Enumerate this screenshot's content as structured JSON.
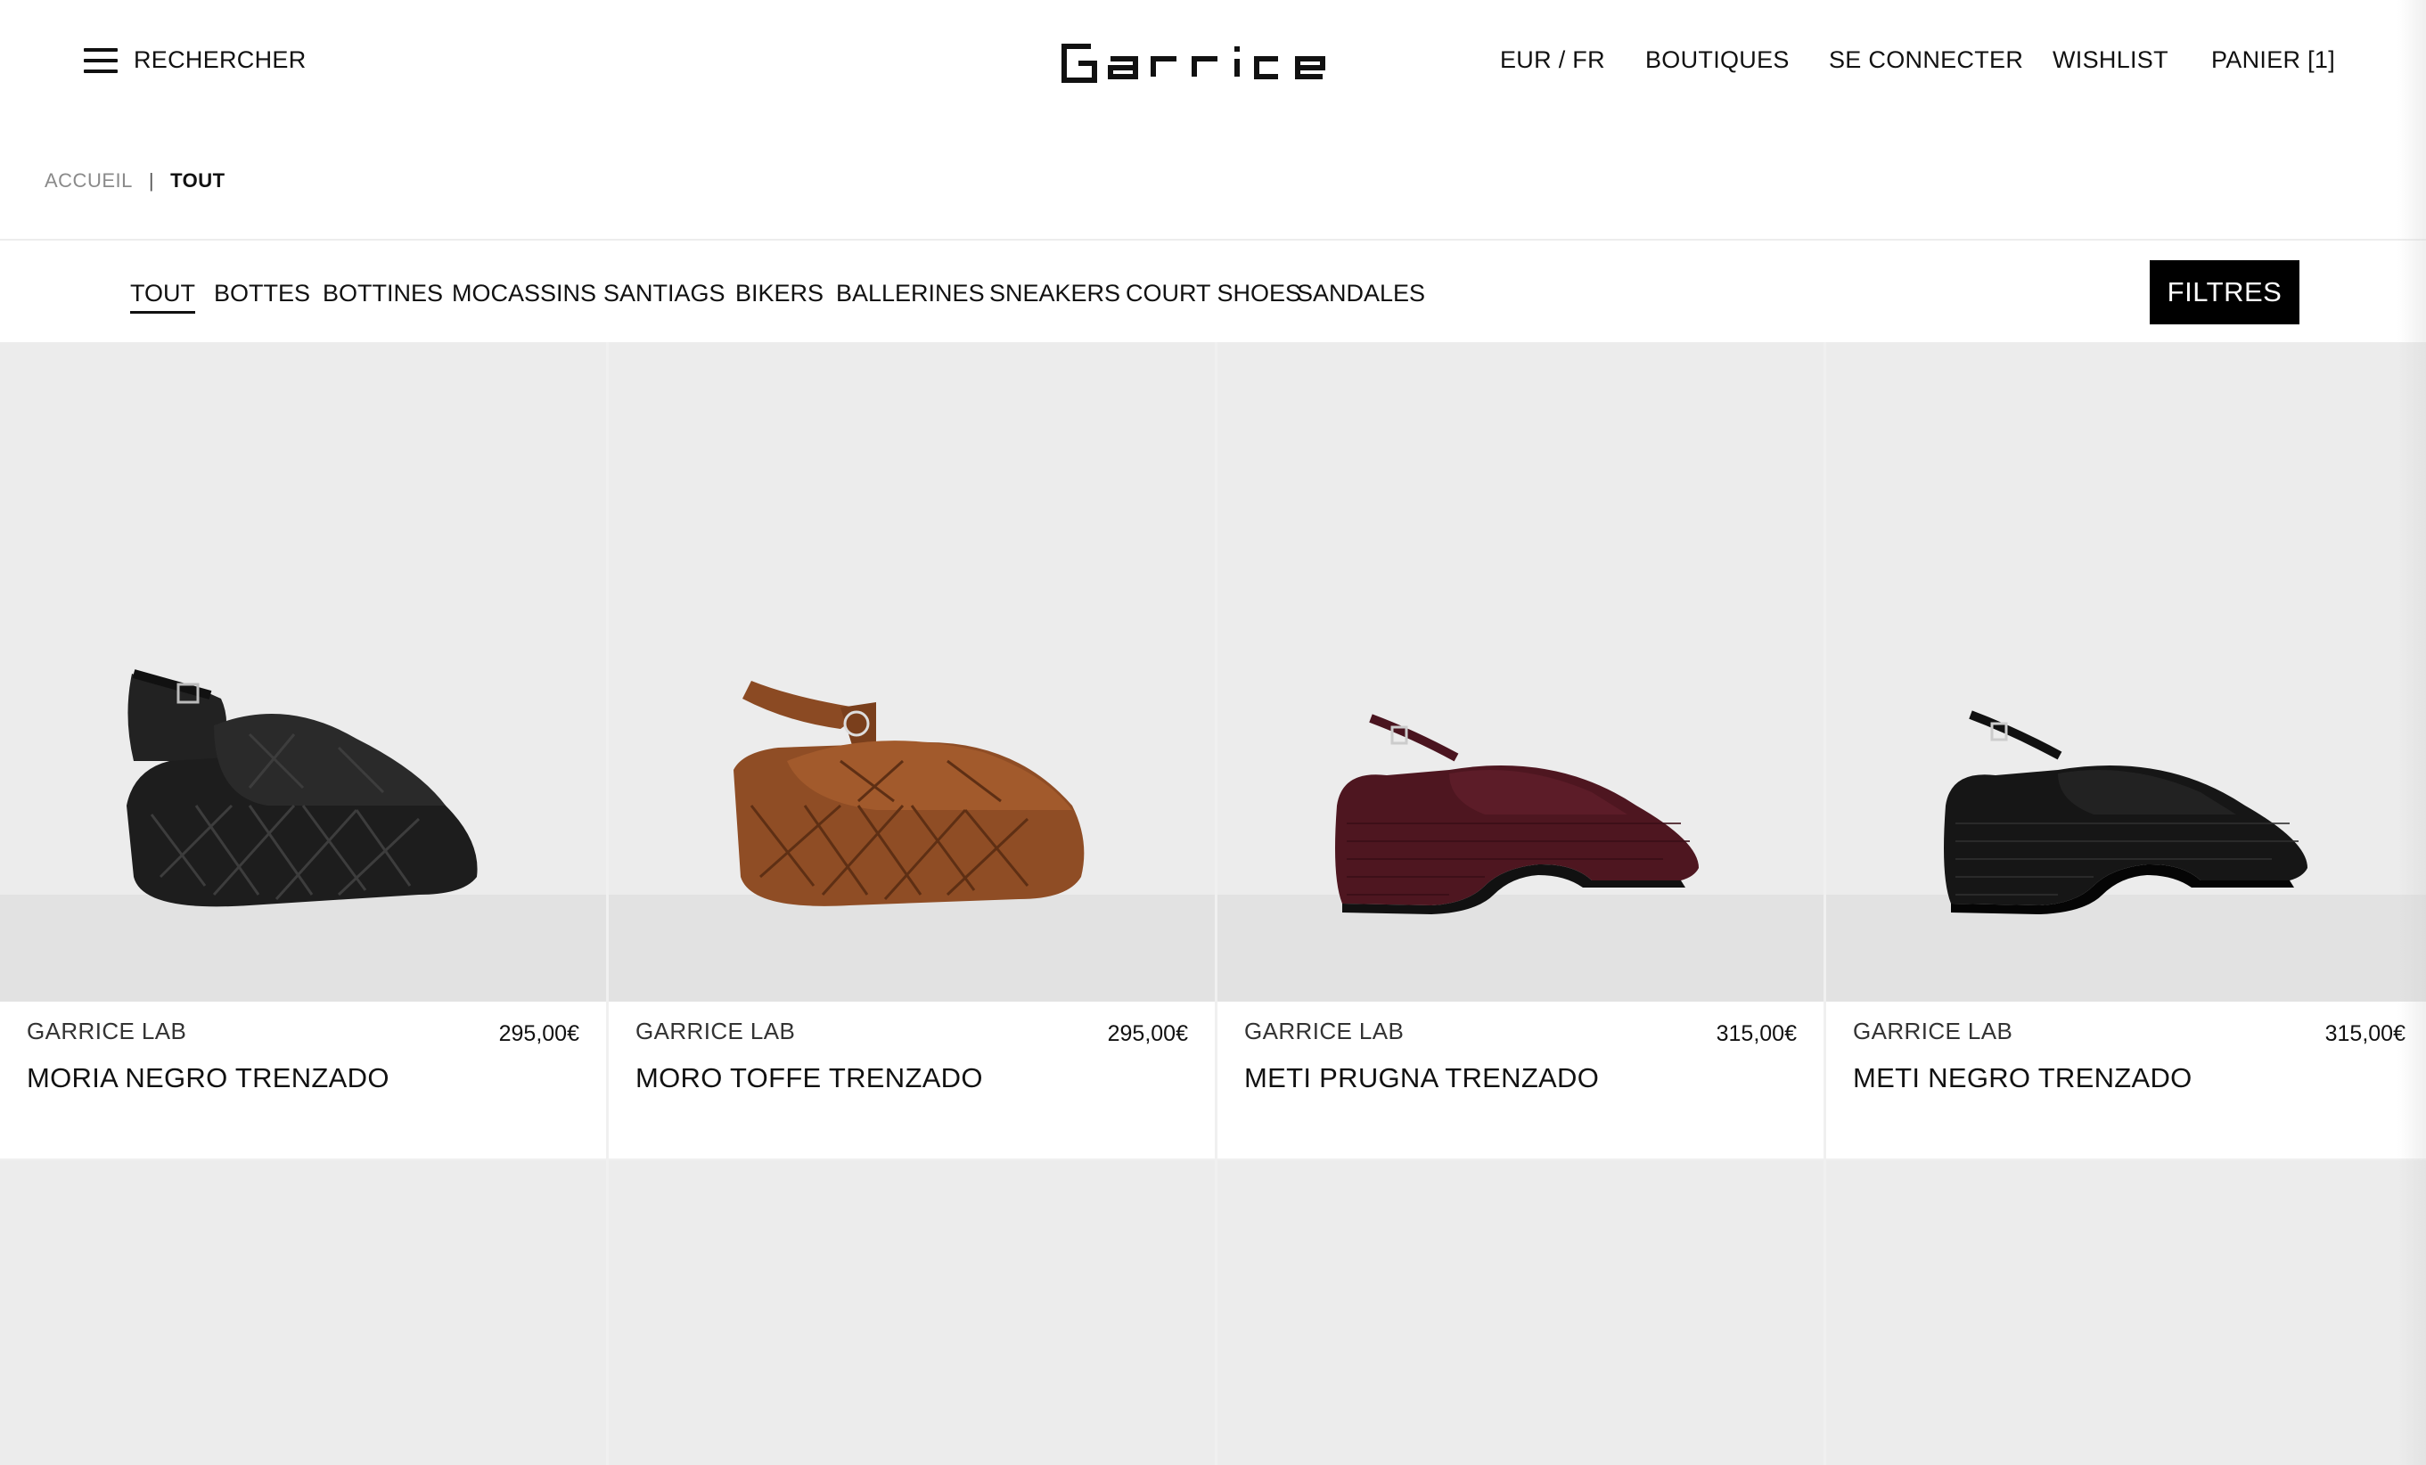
{
  "header": {
    "search_label": "RECHERCHER",
    "logo_text": "Garrice",
    "currency_lang": "EUR / FR",
    "stores": "BOUTIQUES",
    "login": "SE CONNECTER",
    "wishlist": "WISHLIST",
    "cart": "PANIER [1]"
  },
  "breadcrumb": {
    "home": "ACCUEIL",
    "separator": "|",
    "current": "TOUT"
  },
  "categories": [
    "TOUT",
    "BOTTES",
    "BOTTINES",
    "MOCASSINS",
    "SANTIAGS",
    "BIKERS",
    "BALLERINES",
    "SNEAKERS",
    "COURT SHOES",
    "SANDALES"
  ],
  "active_category": "TOUT",
  "filters_label": "FILTRES",
  "products": [
    {
      "brand": "GARRICE LAB",
      "price": "295,00€",
      "name": "MORIA NEGRO TRENZADO",
      "color": "#1b1b1b"
    },
    {
      "brand": "GARRICE LAB",
      "price": "295,00€",
      "name": "MORO TOFFE TRENZADO",
      "color": "#8a4a22"
    },
    {
      "brand": "GARRICE LAB",
      "price": "315,00€",
      "name": "METI PRUGNA TRENZADO",
      "color": "#4e1620"
    },
    {
      "brand": "GARRICE LAB",
      "price": "315,00€",
      "name": "METI NEGRO TRENZADO",
      "color": "#151515"
    }
  ]
}
